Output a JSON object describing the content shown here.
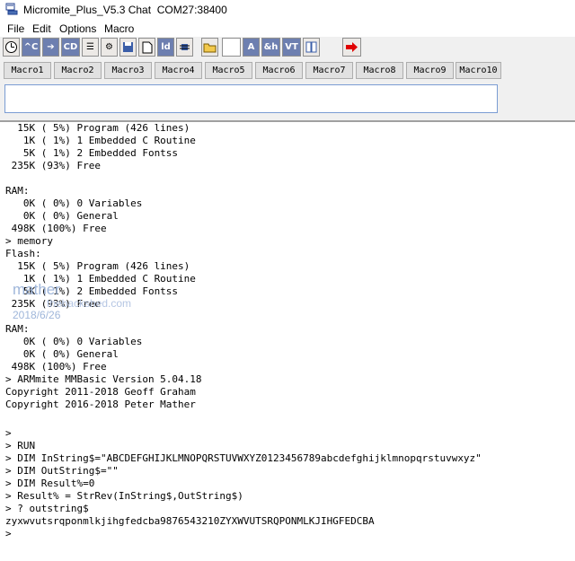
{
  "window": {
    "title": "Micromite_Plus_V5.3 Chat  COM27:38400"
  },
  "menu": [
    "File",
    "Edit",
    "Options",
    "Macro"
  ],
  "toolbar": {
    "icons": [
      "clock-icon",
      "ctrl-c-icon",
      "arrow-right-icon",
      "cd-icon",
      "gear-icon",
      "list-icon",
      "floppy-icon",
      "page-icon",
      "ld-icon",
      "chip-icon",
      "folder-icon",
      "blank-icon",
      "a-icon",
      "ampersand-h-icon",
      "vt-icon",
      "columns-icon",
      "red-arrow-icon"
    ],
    "labels": {
      "ctrl_c": "^C",
      "cd": "CD",
      "ld": "ld",
      "a": "A",
      "ah": "&h",
      "vt": "VT"
    }
  },
  "macros": [
    "Macro1",
    "Macro2",
    "Macro3",
    "Macro4",
    "Macro5",
    "Macro6",
    "Macro7",
    "Macro8",
    "Macro9",
    "Macro10"
  ],
  "input": {
    "value": ""
  },
  "terminal": [
    "  15K ( 5%) Program (426 lines)",
    "   1K ( 1%) 1 Embedded C Routine",
    "   5K ( 1%) 2 Embedded Fontss",
    " 235K (93%) Free",
    "",
    "RAM:",
    "   0K ( 0%) 0 Variables",
    "   0K ( 0%) General",
    " 498K (100%) Free",
    "> memory",
    "Flash:",
    "  15K ( 5%) Program (426 lines)",
    "   1K ( 1%) 1 Embedded C Routine",
    "   5K ( 1%) 2 Embedded Fontss",
    " 235K (93%) Free",
    "",
    "RAM:",
    "   0K ( 0%) 0 Variables",
    "   0K ( 0%) General",
    " 498K (100%) Free",
    "> ARMmite MMBasic Version 5.04.18",
    "Copyright 2011-2018 Geoff Graham",
    "Copyright 2016-2018 Peter Mather",
    "",
    ">",
    "> RUN",
    "> DIM InString$=\"ABCDEFGHIJKLMNOPQRSTUVWXYZ0123456789abcdefghijklmnopqrstuvwxyz\"",
    "> DIM OutString$=\"\"",
    "> DIM Result%=0",
    "> Result% = StrRev(InString$,OutString$)",
    "> ? outstring$",
    "zyxwvutsrqponmlkjihgfedcba9876543210ZYXWVUTSRQPONMLKJIHGFEDCBA",
    ">"
  ],
  "watermark": {
    "name": "mather",
    "site": "thebackshed.com",
    "date": "2018/6/26"
  },
  "colors": {
    "input_border": "#7a9cd3",
    "watermark": "#9fb6da",
    "red_button": "#e00000"
  }
}
